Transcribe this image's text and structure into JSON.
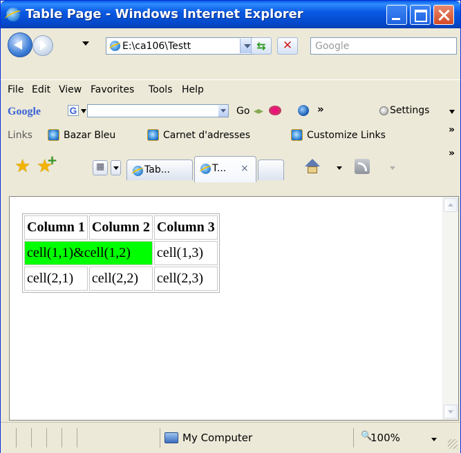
{
  "window": {
    "title": "Table Page - Windows Internet Explorer"
  },
  "toolbar": {
    "address": "E:\\ca106\\Testt",
    "search_placeholder": "Google"
  },
  "menu": [
    "File",
    "Edit",
    "View",
    "Favorites",
    "Tools",
    "Help"
  ],
  "google_bar": {
    "logo": "Google",
    "go_label": "Go",
    "settings_label": "Settings",
    "more": "»"
  },
  "links_bar": {
    "label": "Links",
    "items": [
      "Bazar Bleu",
      "Carnet d'adresses",
      "Customize Links"
    ],
    "more": "»"
  },
  "tabs": [
    {
      "label": "Tab..."
    },
    {
      "label": "T...",
      "close": "×"
    }
  ],
  "tabs_more": "»",
  "table": {
    "headers": [
      "Column 1",
      "Column 2",
      "Column 3"
    ],
    "rows": [
      [
        "cell(1,1)&cell(1,2)",
        "cell(1,3)"
      ],
      [
        "cell(2,1)",
        "cell(2,2)",
        "cell(2,3)"
      ]
    ]
  },
  "status": {
    "zone": "My Computer",
    "zoom": "100%"
  },
  "colors": {
    "merged_cell": "#00ff00",
    "titlebar": "#0a5ae4"
  }
}
